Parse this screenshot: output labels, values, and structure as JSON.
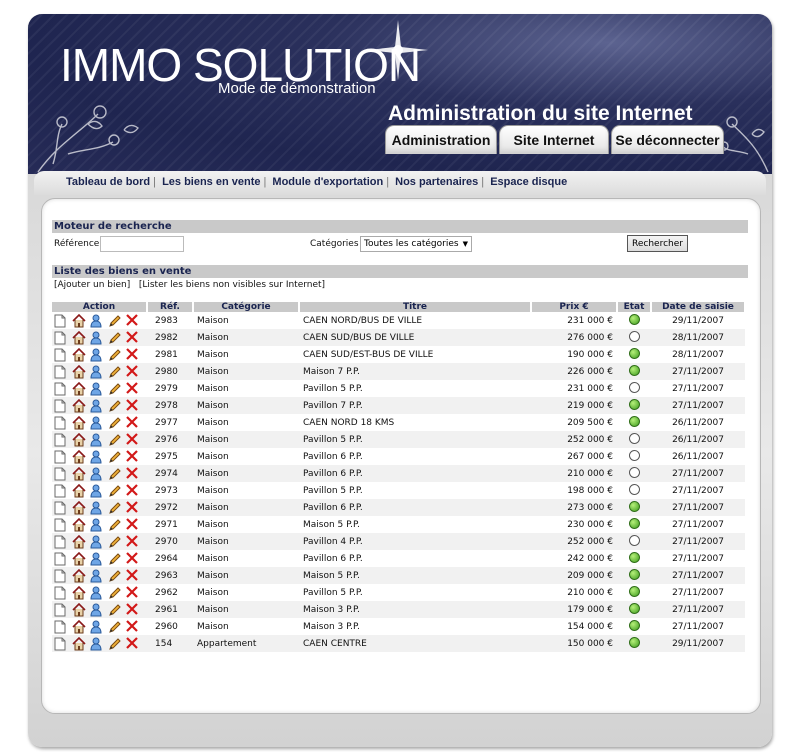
{
  "brand": {
    "logo": "IMMO SOLUTION",
    "subtitle": "Mode de démonstration",
    "admin_title": "Administration du site Internet"
  },
  "main_tabs": [
    "Administration",
    "Site Internet",
    "Se déconnecter"
  ],
  "subnav": [
    "Tableau de bord",
    "Les biens en vente",
    "Module d'exportation",
    "Nos partenaires",
    "Espace disque"
  ],
  "search": {
    "section_title": "Moteur de recherche",
    "ref_label": "Référence",
    "ref_value": "",
    "cat_label": "Catégories",
    "cat_selected": "Toutes les catégories",
    "button": "Rechercher"
  },
  "list": {
    "section_title": "Liste des biens en vente",
    "add_link": "[Ajouter un bien]",
    "hidden_link": "[Lister les biens non visibles sur Internet]",
    "columns": [
      "Action",
      "Réf.",
      "Catégorie",
      "Titre",
      "Prix €",
      "Etat",
      "Date de saisie"
    ],
    "rows": [
      {
        "ref": "2983",
        "cat": "Maison",
        "title": "CAEN NORD/BUS DE VILLE",
        "price": "231 000 €",
        "etat": "on",
        "date": "29/11/2007"
      },
      {
        "ref": "2982",
        "cat": "Maison",
        "title": "CAEN SUD/BUS DE VILLE",
        "price": "276 000 €",
        "etat": "off",
        "date": "28/11/2007"
      },
      {
        "ref": "2981",
        "cat": "Maison",
        "title": "CAEN SUD/EST-BUS DE VILLE",
        "price": "190 000 €",
        "etat": "on",
        "date": "28/11/2007"
      },
      {
        "ref": "2980",
        "cat": "Maison",
        "title": "Maison 7 P.P.",
        "price": "226 000 €",
        "etat": "on",
        "date": "27/11/2007"
      },
      {
        "ref": "2979",
        "cat": "Maison",
        "title": "Pavillon 5 P.P.",
        "price": "231 000 €",
        "etat": "off",
        "date": "27/11/2007"
      },
      {
        "ref": "2978",
        "cat": "Maison",
        "title": "Pavillon 7 P.P.",
        "price": "219 000 €",
        "etat": "on",
        "date": "27/11/2007"
      },
      {
        "ref": "2977",
        "cat": "Maison",
        "title": "CAEN NORD 18 KMS",
        "price": "209 500 €",
        "etat": "on",
        "date": "26/11/2007"
      },
      {
        "ref": "2976",
        "cat": "Maison",
        "title": "Pavillon 5 P.P.",
        "price": "252 000 €",
        "etat": "off",
        "date": "26/11/2007"
      },
      {
        "ref": "2975",
        "cat": "Maison",
        "title": "Pavillon 6 P.P.",
        "price": "267 000 €",
        "etat": "off",
        "date": "26/11/2007"
      },
      {
        "ref": "2974",
        "cat": "Maison",
        "title": "Pavillon 6 P.P.",
        "price": "210 000 €",
        "etat": "off",
        "date": "27/11/2007"
      },
      {
        "ref": "2973",
        "cat": "Maison",
        "title": "Pavillon 5 P.P.",
        "price": "198 000 €",
        "etat": "off",
        "date": "27/11/2007"
      },
      {
        "ref": "2972",
        "cat": "Maison",
        "title": "Pavillon 6 P.P.",
        "price": "273 000 €",
        "etat": "on",
        "date": "27/11/2007"
      },
      {
        "ref": "2971",
        "cat": "Maison",
        "title": "Maison 5 P.P.",
        "price": "230 000 €",
        "etat": "on",
        "date": "27/11/2007"
      },
      {
        "ref": "2970",
        "cat": "Maison",
        "title": "Pavillon 4 P.P.",
        "price": "252 000 €",
        "etat": "off",
        "date": "27/11/2007"
      },
      {
        "ref": "2964",
        "cat": "Maison",
        "title": "Pavillon 6 P.P.",
        "price": "242 000 €",
        "etat": "on",
        "date": "27/11/2007"
      },
      {
        "ref": "2963",
        "cat": "Maison",
        "title": "Maison 5 P.P.",
        "price": "209 000 €",
        "etat": "on",
        "date": "27/11/2007"
      },
      {
        "ref": "2962",
        "cat": "Maison",
        "title": "Pavillon 5 P.P.",
        "price": "210 000 €",
        "etat": "on",
        "date": "27/11/2007"
      },
      {
        "ref": "2961",
        "cat": "Maison",
        "title": "Maison 3 P.P.",
        "price": "179 000 €",
        "etat": "on",
        "date": "27/11/2007"
      },
      {
        "ref": "2960",
        "cat": "Maison",
        "title": "Maison 3 P.P.",
        "price": "154 000 €",
        "etat": "on",
        "date": "27/11/2007"
      },
      {
        "ref": "154",
        "cat": "Appartement",
        "title": "CAEN CENTRE",
        "price": "150 000 €",
        "etat": "on",
        "date": "29/11/2007"
      }
    ]
  },
  "icons": {
    "view": "document-icon",
    "home": "house-icon",
    "client": "person-icon",
    "edit": "pencil-icon",
    "delete": "delete-cross-icon"
  },
  "colors": {
    "header_navy": "#1f2550",
    "link_navy": "#1a2450",
    "status_green": "#3c9b1c",
    "delete_red": "#d21818"
  }
}
